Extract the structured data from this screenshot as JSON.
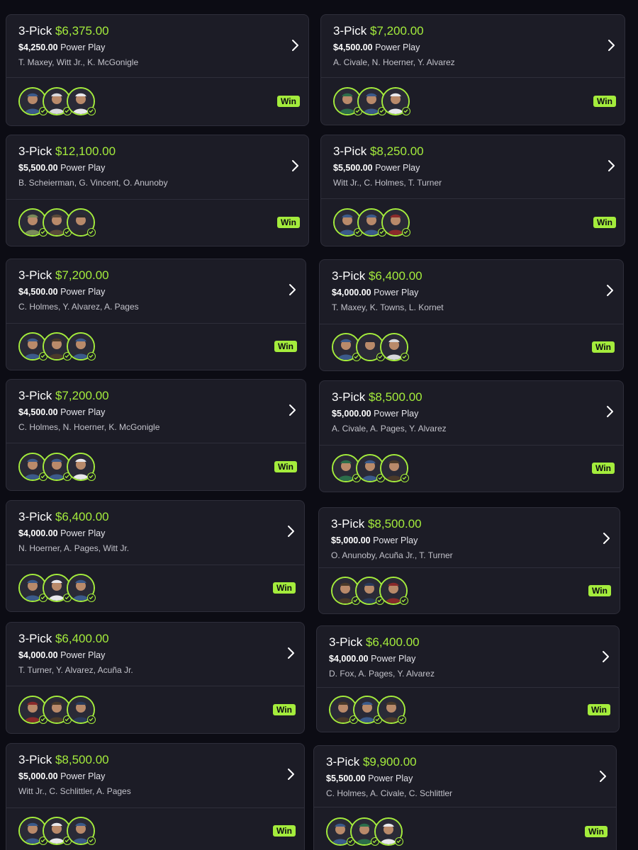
{
  "colors": {
    "accent": "#a4ec3c",
    "card_bg": "#1c1c26",
    "page_bg": "#0c0c14"
  },
  "icons": {
    "arrow": "chevron-right-icon",
    "status": "check-circle-icon",
    "player": "player-avatar"
  },
  "entries": [
    {
      "title": "3-Pick",
      "payout": "$6,375.00",
      "stake": "$4,250.00",
      "play_type": "Power Play",
      "players": "T. Maxey, Witt Jr., K. McGonigle",
      "status": "Win"
    },
    {
      "title": "3-Pick",
      "payout": "$7,200.00",
      "stake": "$4,500.00",
      "play_type": "Power Play",
      "players": "A. Civale, N. Hoerner, Y. Alvarez",
      "status": "Win"
    },
    {
      "title": "3-Pick",
      "payout": "$12,100.00",
      "stake": "$5,500.00",
      "play_type": "Power Play",
      "players": "B. Scheierman, G. Vincent, O. Anunoby",
      "status": "Win"
    },
    {
      "title": "3-Pick",
      "payout": "$8,250.00",
      "stake": "$5,500.00",
      "play_type": "Power Play",
      "players": "Witt Jr., C. Holmes, T. Turner",
      "status": "Win"
    },
    {
      "title": "3-Pick",
      "payout": "$7,200.00",
      "stake": "$4,500.00",
      "play_type": "Power Play",
      "players": "C. Holmes, Y. Alvarez, A. Pages",
      "status": "Win"
    },
    {
      "title": "3-Pick",
      "payout": "$6,400.00",
      "stake": "$4,000.00",
      "play_type": "Power Play",
      "players": "T. Maxey, K. Towns, L. Kornet",
      "status": "Win"
    },
    {
      "title": "3-Pick",
      "payout": "$7,200.00",
      "stake": "$4,500.00",
      "play_type": "Power Play",
      "players": "C. Holmes, N. Hoerner, K. McGonigle",
      "status": "Win"
    },
    {
      "title": "3-Pick",
      "payout": "$8,500.00",
      "stake": "$5,000.00",
      "play_type": "Power Play",
      "players": "A. Civale, A. Pages, Y. Alvarez",
      "status": "Win"
    },
    {
      "title": "3-Pick",
      "payout": "$6,400.00",
      "stake": "$4,000.00",
      "play_type": "Power Play",
      "players": "N. Hoerner, A. Pages, Witt Jr.",
      "status": "Win"
    },
    {
      "title": "3-Pick",
      "payout": "$8,500.00",
      "stake": "$5,000.00",
      "play_type": "Power Play",
      "players": "O. Anunoby, Acuña Jr., T. Turner",
      "status": "Win"
    },
    {
      "title": "3-Pick",
      "payout": "$6,400.00",
      "stake": "$4,000.00",
      "play_type": "Power Play",
      "players": "T. Turner, Y. Alvarez, Acuña Jr.",
      "status": "Win"
    },
    {
      "title": "3-Pick",
      "payout": "$6,400.00",
      "stake": "$4,000.00",
      "play_type": "Power Play",
      "players": "D. Fox, A. Pages, Y. Alvarez",
      "status": "Win"
    },
    {
      "title": "3-Pick",
      "payout": "$8,500.00",
      "stake": "$5,000.00",
      "play_type": "Power Play",
      "players": "Witt Jr., C. Schlittler, A. Pages",
      "status": "Win"
    },
    {
      "title": "3-Pick",
      "payout": "$9,900.00",
      "stake": "$5,500.00",
      "play_type": "Power Play",
      "players": "C. Holmes, A. Civale, C. Schlittler",
      "status": "Win"
    }
  ]
}
